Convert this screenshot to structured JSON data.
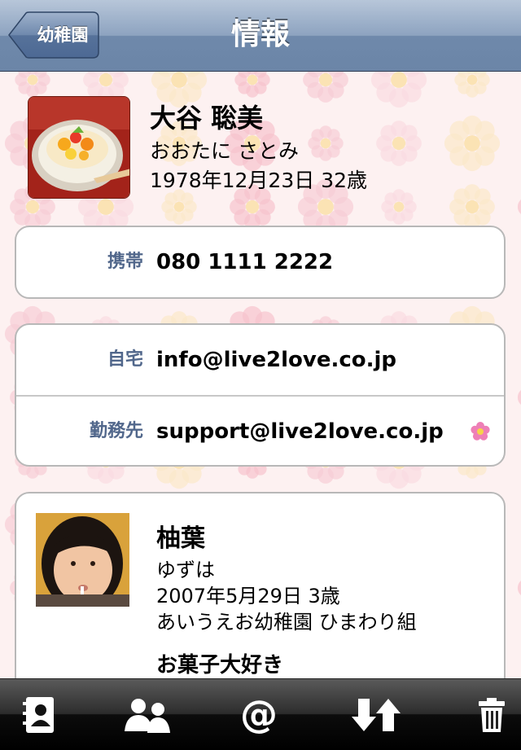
{
  "navbar": {
    "back_label": "幼稚園",
    "title": "情報"
  },
  "profile": {
    "name": "大谷 聡美",
    "kana": "おおたに さとみ",
    "dob": "1978年12月23日  32歳"
  },
  "phone": {
    "label": "携帯",
    "value": "080 1111 2222"
  },
  "emails": [
    {
      "label": "自宅",
      "value": "info@live2love.co.jp"
    },
    {
      "label": "勤務先",
      "value": "support@live2love.co.jp"
    }
  ],
  "child": {
    "name": "柚葉",
    "kana": "ゆずは",
    "dob": "2007年5月29日  3歳",
    "school": "あいうえお幼稚園  ひまわり組",
    "note": "お菓子大好き"
  },
  "toolbar": {
    "icons": [
      "address-book-icon",
      "group-icon",
      "at-icon",
      "sort-icon",
      "trash-icon"
    ]
  },
  "colors": {
    "label_blue": "#51678b",
    "nav_blue": "#6f89ab",
    "flower_pink": "#f5c6cf"
  }
}
